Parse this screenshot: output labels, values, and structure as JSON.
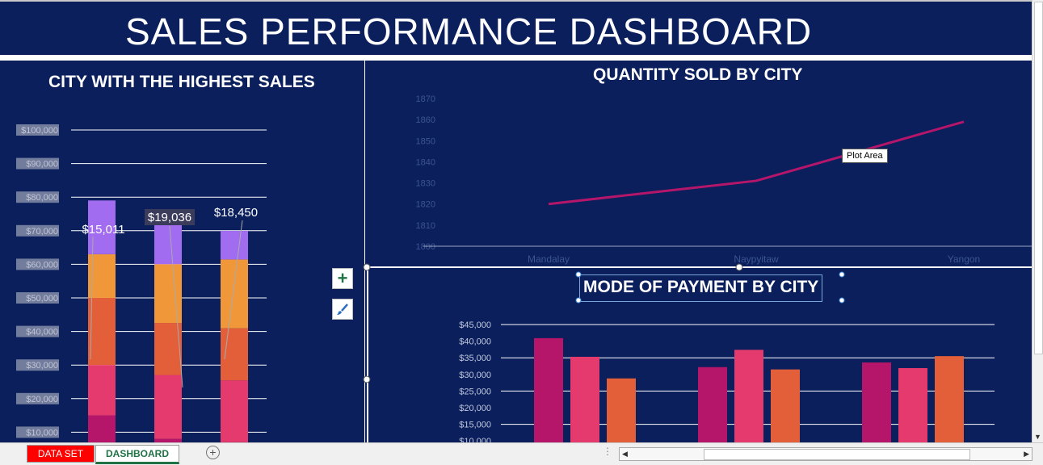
{
  "dashboard_title": "SALES PERFORMANCE DASHBOARD",
  "tooltip": "Plot Area",
  "tabs": {
    "data_set": "DATA SET",
    "dashboard": "DASHBOARD"
  },
  "icons": {
    "add_element": "plus-icon",
    "chart_styles": "paintbrush-icon",
    "add_sheet": "plus-circle-icon"
  },
  "colors": {
    "background": "#0a1f5c",
    "series_1": "#b5166a",
    "series_2": "#e53a6e",
    "series_3": "#e35f3a",
    "series_4": "#f0973a",
    "series_5": "#a16cf0",
    "data_set_tab": "#ff0000"
  },
  "chart_data": [
    {
      "type": "bar",
      "stacked": true,
      "title": "CITY WITH THE HIGHEST SALES",
      "ylim": [
        0,
        100000
      ],
      "y_ticks": [
        "$10,000",
        "$20,000",
        "$30,000",
        "$40,000",
        "$50,000",
        "$60,000",
        "$70,000",
        "$80,000",
        "$90,000",
        "$100,000"
      ],
      "category_count": 3,
      "series": [
        {
          "values": [
            15011,
            8000,
            7000
          ]
        },
        {
          "values": [
            15000,
            19036,
            18450
          ]
        },
        {
          "values": [
            20000,
            15500,
            15500
          ]
        },
        {
          "values": [
            13000,
            17500,
            20500
          ]
        },
        {
          "values": [
            16000,
            12000,
            8500
          ]
        }
      ],
      "data_labels": [
        "$15,011",
        "$19,036",
        "$18,450"
      ],
      "grid": true
    },
    {
      "type": "line",
      "title": "QUANTITY SOLD BY CITY",
      "categories": [
        "Mandalay",
        "Naypyitaw",
        "Yangon"
      ],
      "values": [
        1820,
        1831,
        1859
      ],
      "ylim": [
        1800,
        1870
      ],
      "y_ticks": [
        "1800",
        "1810",
        "1820",
        "1830",
        "1840",
        "1850",
        "1860",
        "1870"
      ],
      "grid": false
    },
    {
      "type": "bar",
      "title": "MODE OF PAYMENT BY CITY",
      "category_count": 3,
      "ylim": [
        10000,
        45000
      ],
      "y_ticks": [
        "$10,000",
        "$15,000",
        "$20,000",
        "$25,000",
        "$30,000",
        "$35,000",
        "$40,000",
        "$45,000"
      ],
      "series": [
        {
          "values": [
            40900,
            32200,
            33600
          ]
        },
        {
          "values": [
            35300,
            37400,
            31900
          ]
        },
        {
          "values": [
            28800,
            31500,
            35500
          ]
        }
      ],
      "grid": true
    }
  ]
}
